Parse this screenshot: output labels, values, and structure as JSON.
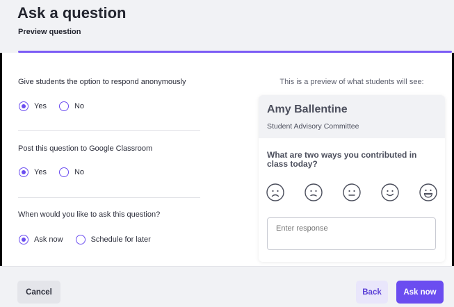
{
  "header": {
    "title": "Ask a question",
    "subtitle": "Preview question"
  },
  "form": {
    "anonymous": {
      "label": "Give students the option to respond anonymously",
      "options": [
        "Yes",
        "No"
      ],
      "selected": "Yes"
    },
    "classroom": {
      "label": "Post this question to Google Classroom",
      "options": [
        "Yes",
        "No"
      ],
      "selected": "Yes"
    },
    "timing": {
      "label": "When would you like to ask this question?",
      "options": [
        "Ask now",
        "Schedule for later"
      ],
      "selected": "Ask now"
    }
  },
  "preview": {
    "caption": "This is a preview of what students will see:",
    "name": "Amy Ballentine",
    "org": "Student Advisory Committee",
    "question": "What are two ways you contributed in class today?",
    "emojis": [
      "frown-face-icon",
      "confused-face-icon",
      "neutral-face-icon",
      "smile-face-icon",
      "grin-face-icon"
    ],
    "response_placeholder": "Enter response"
  },
  "footer": {
    "cancel": "Cancel",
    "back": "Back",
    "ask_now": "Ask now"
  },
  "colors": {
    "accent": "#6b4df0",
    "header_bg": "#f1f2f5"
  }
}
